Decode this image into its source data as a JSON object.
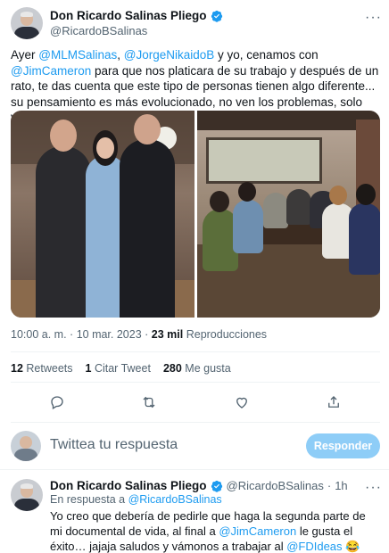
{
  "tweet": {
    "author": {
      "name": "Don Ricardo Salinas Pliego",
      "handle": "@RicardoBSalinas",
      "verified_color": "#1d9bf0"
    },
    "more_icon": "more-dots-icon",
    "text_parts": {
      "p1": "Ayer ",
      "m1": "@MLMSalinas",
      "p2": ", ",
      "m2": "@JorgeNikaidoB",
      "p3": " y yo, cenamos con ",
      "m3": "@JimCameron",
      "p4": " para que nos platicara de su trabajo y después de un rato, te das cuenta que este tipo de personas tienen algo diferente... su pensamiento es más evolucionado, no ven los problemas, solo ven oportunidades 🤯"
    },
    "time": "10:00 a. m.",
    "separator": "·",
    "date": "10 mar. 2023",
    "views_count": "23 mil",
    "views_label": "Reproducciones",
    "stats": {
      "retweets_count": "12",
      "retweets_label": "Retweets",
      "quotes_count": "1",
      "quotes_label": "Citar Tweet",
      "likes_count": "280",
      "likes_label": "Me gusta"
    },
    "actions": [
      "reply-icon",
      "retweet-icon",
      "like-icon",
      "share-icon"
    ]
  },
  "composer": {
    "placeholder": "Twittea tu respuesta",
    "button_label": "Responder"
  },
  "reply": {
    "author": {
      "name": "Don Ricardo Salinas Pliego",
      "handle": "@RicardoBSalinas",
      "dot": "·",
      "time": "1h"
    },
    "replying_prefix": "En respuesta a ",
    "replying_to": "@RicardoBSalinas",
    "text_parts": {
      "p1": "Yo creo que debería de pedirle que haga la segunda parte de mi documental de vida, al final a ",
      "m1": "@JimCameron",
      "p2": " le gusta el éxito… jajaja saludos y vámonos a trabajar al ",
      "m2": "@FDIdeas",
      "p3": " 😂"
    }
  },
  "colors": {
    "accent": "#1d9bf0",
    "muted": "#536471",
    "button_disabled": "#8ecdf7"
  }
}
